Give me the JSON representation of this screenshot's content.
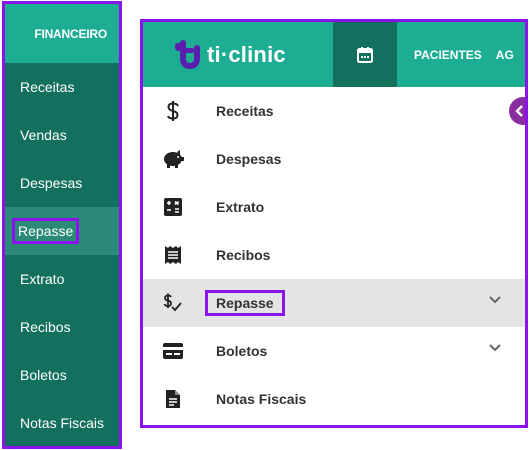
{
  "left_menu": {
    "header": "FINANCEIRO",
    "items": [
      {
        "label": "Receitas"
      },
      {
        "label": "Vendas"
      },
      {
        "label": "Despesas"
      },
      {
        "label": "Repasse"
      },
      {
        "label": "Extrato"
      },
      {
        "label": "Recibos"
      },
      {
        "label": "Boletos"
      },
      {
        "label": "Notas Fiscais"
      }
    ],
    "active_item": "Repasse"
  },
  "app": {
    "brand": "ti·clinic",
    "nav": [
      {
        "label": "PACIENTES"
      },
      {
        "label": "AG"
      }
    ],
    "calendar_icon": "calendar-icon"
  },
  "side_menu": {
    "items": [
      {
        "label": "Receitas",
        "icon": "dollar-icon"
      },
      {
        "label": "Despesas",
        "icon": "piggy-bank-icon"
      },
      {
        "label": "Extrato",
        "icon": "calculator-icon"
      },
      {
        "label": "Recibos",
        "icon": "receipt-icon"
      },
      {
        "label": "Repasse",
        "icon": "dollar-check-icon",
        "expandable": true
      },
      {
        "label": "Boletos",
        "icon": "card-icon",
        "expandable": true
      },
      {
        "label": "Notas Fiscais",
        "icon": "document-icon"
      }
    ],
    "active_item": "Repasse"
  },
  "colors": {
    "brand_green": "#1cad92",
    "dark_green": "#14705e",
    "highlight_purple": "#8a12ea",
    "active_row": "#e4e4e6"
  }
}
